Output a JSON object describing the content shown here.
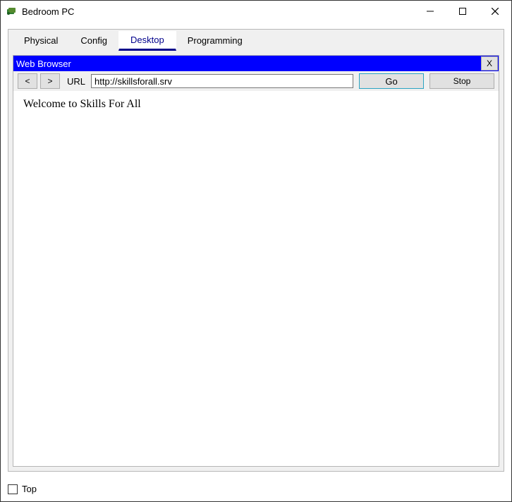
{
  "window": {
    "title": "Bedroom PC"
  },
  "tabs": {
    "physical": "Physical",
    "config": "Config",
    "desktop": "Desktop",
    "programming": "Programming"
  },
  "browser": {
    "title": "Web Browser",
    "close_label": "X",
    "back_label": "<",
    "forward_label": ">",
    "url_label": "URL",
    "url_value": "http://skillsforall.srv",
    "go_label": "Go",
    "stop_label": "Stop",
    "page_text": "Welcome to Skills For All"
  },
  "footer": {
    "top_label": "Top"
  }
}
